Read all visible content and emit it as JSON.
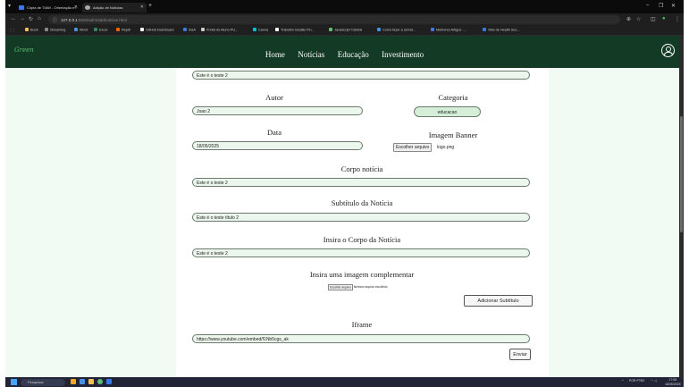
{
  "browser": {
    "tabs": [
      {
        "title": "Cópia de TIAW - Orientação e i"
      },
      {
        "title": "Adição de Notícias"
      }
    ],
    "new_tab": "+",
    "url_host": "127.0.0.1",
    "url_path": ":5500/adm/addnoticias.html",
    "bookmarks": [
      {
        "label": "Book",
        "color": "#f2c14e"
      },
      {
        "label": "Streaming",
        "color": "#888888"
      },
      {
        "label": "Word",
        "color": "#4a90e2"
      },
      {
        "label": "Excel",
        "color": "#2e8b57"
      },
      {
        "label": "Replit",
        "color": "#f26207"
      },
      {
        "label": "GitHub Dashboard",
        "color": "#ffffff"
      },
      {
        "label": "SGA",
        "color": "#3b7dd8"
      },
      {
        "label": "Portal do Aluno PU...",
        "color": "#cccccc"
      },
      {
        "label": "Canva",
        "color": "#00c4cc"
      },
      {
        "label": "Trabalho Gestão Fin...",
        "color": "#ffffff"
      },
      {
        "label": "JavaScript Tutorial",
        "color": "#5bbf6e"
      },
      {
        "label": "Como fazer a servid...",
        "color": "#4a90e2"
      },
      {
        "label": "Melhores Artigos -...",
        "color": "#3b78e7"
      },
      {
        "label": "Vida de Health Sce...",
        "color": "#3b78e7"
      }
    ]
  },
  "site": {
    "logo": "Green",
    "nav": [
      "Home",
      "Notícias",
      "Educação",
      "Investimento"
    ]
  },
  "form": {
    "title_value": "Este é o teste 2",
    "author_label": "Autor",
    "author_value": "Joao 2",
    "category_label": "Categoria",
    "category_value": "educacao",
    "date_label": "Data",
    "date_value": "18/05/2025",
    "banner_label": "Imagem Banner",
    "banner_button": "Escolher arquivo",
    "banner_file": "logo.png",
    "body_label": "Corpo notícia",
    "body_value": "Este é o teste 2",
    "subtitle_label": "Subtítulo da Notícia",
    "subtitle_value": "Este é o teste título 2",
    "subbody_label": "Insira o Corpo da Notícia",
    "subbody_value": "Este é o teste 2",
    "extra_image_label": "Insira uma imagem complementar",
    "extra_image_button": "Escolher arquivo",
    "extra_image_status": "Nenhum arquivo escolhido",
    "add_subtitle_button": "Adicionar Subtítulo",
    "iframe_label": "Iframe",
    "iframe_value": "https://www.youtube.com/embed/f1Nb5cgs_ak",
    "submit_button": "Enviar"
  },
  "taskbar": {
    "search_placeholder": "Pesquisar",
    "time": "17:05",
    "date": "18/05/2025",
    "lang": "POR PTB2"
  }
}
